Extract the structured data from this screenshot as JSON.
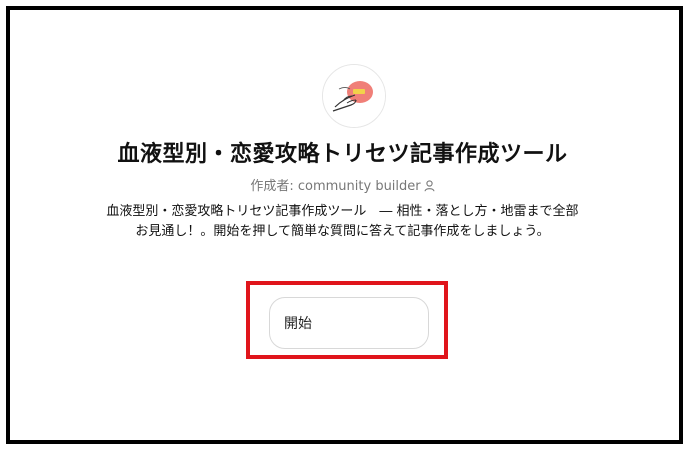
{
  "app": {
    "title": "血液型別・恋愛攻略トリセツ記事作成ツール",
    "author": "作成者: community builder",
    "author_icon": "person-icon",
    "avatar_icon": "hand-holding-egg-illustration",
    "description_line1": "血液型別・恋愛攻略トリセツ記事作成ツール　― 相性・落とし方・地雷まで全部",
    "description_line2": "お見通し！。開始を押して簡単な質問に答えて記事作成をしましょう。"
  },
  "actions": {
    "start_label": "開始"
  },
  "colors": {
    "highlight": "#e0151b",
    "frame": "#000000"
  }
}
